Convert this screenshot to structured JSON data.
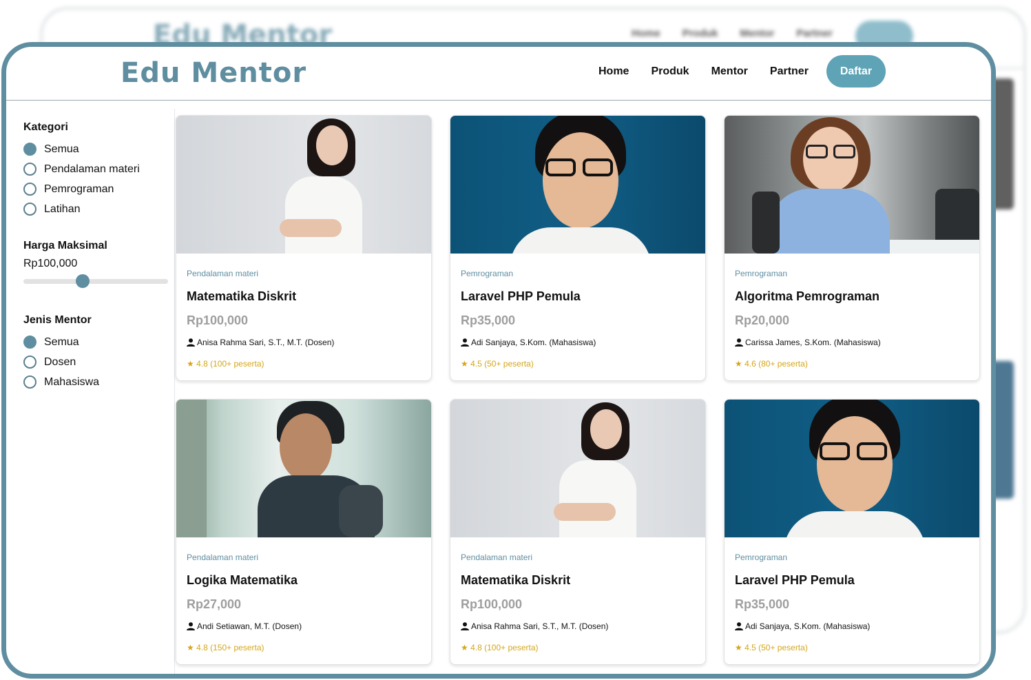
{
  "app": {
    "logo": "Edu Mentor",
    "nav": [
      "Home",
      "Produk",
      "Mentor",
      "Partner"
    ],
    "cta": "Daftar"
  },
  "filters": {
    "category": {
      "title": "Kategori",
      "options": [
        "Semua",
        "Pendalaman materi",
        "Pemrograman",
        "Latihan"
      ],
      "selected": "Semua"
    },
    "price": {
      "title": "Harga Maksimal",
      "value": "Rp100,000",
      "level": 0.41
    },
    "mentor_type": {
      "title": "Jenis Mentor",
      "options": [
        "Semua",
        "Dosen",
        "Mahasiswa"
      ],
      "selected": "Semua"
    }
  },
  "colors": {
    "accent": "#5f8ea0",
    "button": "#5fa3b7",
    "rating": "#d4a619",
    "price": "#9e9e9e"
  },
  "courses": [
    {
      "category": "Pendalaman materi",
      "title": "Matematika Diskrit",
      "price": "Rp100,000",
      "mentor": "Anisa Rahma Sari, S.T., M.T. (Dosen)",
      "rating": "★ 4.8 (100+ peserta)",
      "photo": "woman-white-shirt"
    },
    {
      "category": "Pemrograman",
      "title": "Laravel PHP Pemula",
      "price": "Rp35,000",
      "mentor": "Adi Sanjaya, S.Kom. (Mahasiswa)",
      "rating": "★ 4.5 (50+ peserta)",
      "photo": "man-glasses-blue"
    },
    {
      "category": "Pemrograman",
      "title": "Algoritma Pemrograman",
      "price": "Rp20,000",
      "mentor": "Carissa James, S.Kom. (Mahasiswa)",
      "rating": "★ 4.6 (80+ peserta)",
      "photo": "woman-glasses-office"
    },
    {
      "category": "Pendalaman materi",
      "title": "Logika Matematika",
      "price": "Rp27,000",
      "mentor": "Andi Setiawan, M.T. (Dosen)",
      "rating": "★ 4.8 (150+ peserta)",
      "photo": "man-backpack-window"
    },
    {
      "category": "Pendalaman materi",
      "title": "Matematika Diskrit",
      "price": "Rp100,000",
      "mentor": "Anisa Rahma Sari, S.T., M.T. (Dosen)",
      "rating": "★ 4.8 (100+ peserta)",
      "photo": "woman-white-shirt"
    },
    {
      "category": "Pemrograman",
      "title": "Laravel PHP Pemula",
      "price": "Rp35,000",
      "mentor": "Adi Sanjaya, S.Kom. (Mahasiswa)",
      "rating": "★ 4.5 (50+ peserta)",
      "photo": "man-glasses-blue"
    }
  ]
}
